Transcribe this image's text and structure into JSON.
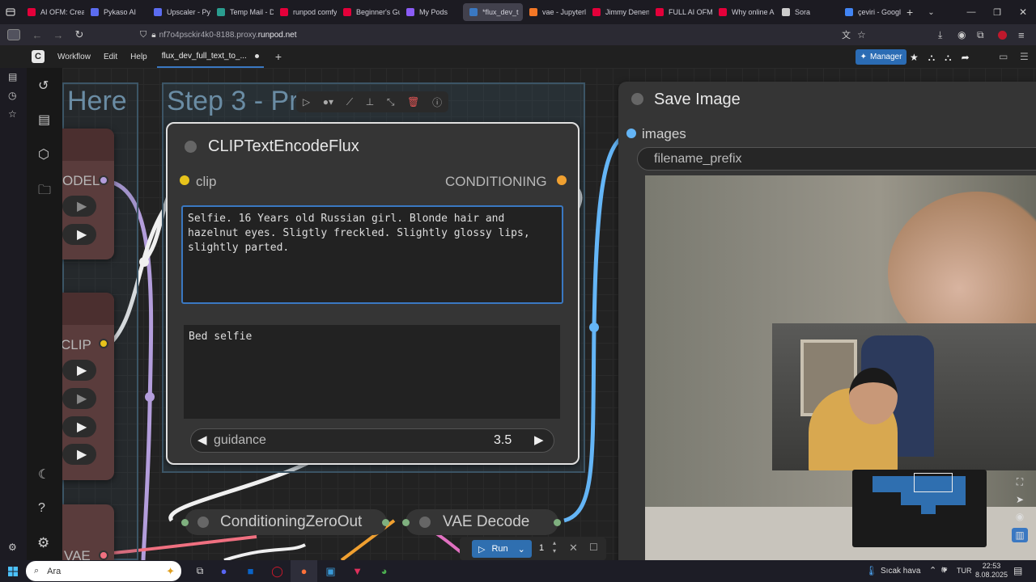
{
  "browser": {
    "tabs": [
      {
        "label": "AI OFM: Crea",
        "color": "#e4003a"
      },
      {
        "label": "Pykaso AI",
        "color": "#5b6cf0"
      },
      {
        "label": "Upscaler - Py",
        "color": "#5b6cf0"
      },
      {
        "label": "Temp Mail - D",
        "color": "#2a9d8f"
      },
      {
        "label": "runpod comfy",
        "color": "#e4003a"
      },
      {
        "label": "Beginner's Gu",
        "color": "#e4003a"
      },
      {
        "label": "My Pods",
        "color": "#8b5cf6"
      },
      {
        "label": "*flux_dev_t",
        "color": "#3a78c2",
        "active": true
      },
      {
        "label": "vae - Jupyterl",
        "color": "#f37726"
      },
      {
        "label": "Jimmy Denen",
        "color": "#e4003a"
      },
      {
        "label": "FULL AI OFM",
        "color": "#e4003a"
      },
      {
        "label": "Why online A",
        "color": "#e4003a"
      },
      {
        "label": "Sora",
        "color": "#cccccc"
      },
      {
        "label": "çeviri - Googl",
        "color": "#4285f4"
      }
    ],
    "url_prefix": "nf7o4psckir4k0-8188.proxy.",
    "url_domain": "runpod.net"
  },
  "menu": {
    "items": [
      "Workflow",
      "Edit",
      "Help"
    ],
    "workflow_tab": "flux_dev_full_text_to_...",
    "manager_label": "Manager"
  },
  "canvas": {
    "group_left_title": "Here",
    "group_step3_title": "Step 3 - Pr",
    "left_node": {
      "model_label": "ODEL",
      "clip_label": "CLIP",
      "vae_label": "VAE"
    },
    "clip_node": {
      "title": "CLIPTextEncodeFlux",
      "input_label": "clip",
      "output_label": "CONDITIONING",
      "clip_l_text": "Selfie. 16 Years old Russian girl. Blonde hair and\nhazelnut eyes. Sligtly freckled. Slightly glossy lips,\nslightly parted.",
      "t5xxl_text": "Bed selfie",
      "guidance_label": "guidance",
      "guidance_value": "3.5"
    },
    "save_node": {
      "title": "Save Image",
      "input_label": "images",
      "filename_label": "filename_prefix"
    },
    "cond_zero_title": "ConditioningZeroOut",
    "vae_decode_title": "VAE Decode",
    "run_label": "Run",
    "run_count": "1"
  },
  "colors": {
    "clip_yellow": "#e7c31b",
    "conditioning_orange": "#f0a030",
    "image_blue": "#64b5f6",
    "model_purple": "#b39ddb",
    "accent_blue": "#3a78c2"
  },
  "taskbar": {
    "search_placeholder": "Ara",
    "weather": "Sıcak hava",
    "lang": "TUR",
    "time": "22:53",
    "date": "8.08.2025"
  }
}
